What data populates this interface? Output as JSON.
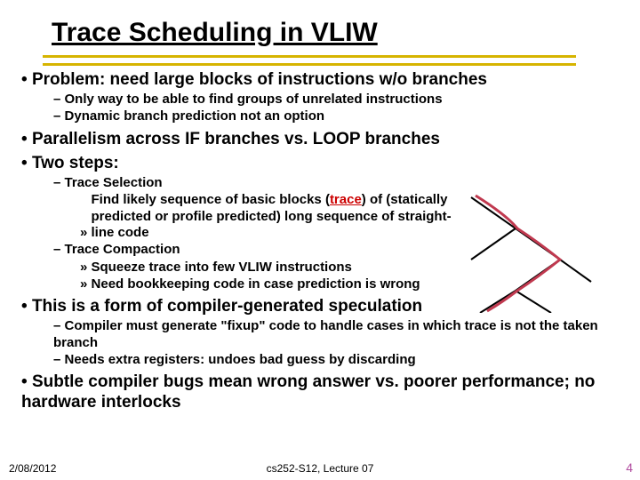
{
  "title": "Trace Scheduling in VLIW",
  "b1": {
    "problem": "Problem: need large blocks of instructions w/o branches",
    "sub1": "Only way to be able to find groups of unrelated instructions",
    "sub2": "Dynamic branch prediction not an option"
  },
  "b2": "Parallelism across IF branches vs. LOOP branches",
  "b3": {
    "head": "Two steps:",
    "ts": "Trace Selection",
    "ts_detail_pre": "Find likely sequence of basic blocks (",
    "ts_detail_link": "trace",
    "ts_detail_post": ") of (statically predicted or profile predicted) long sequence of straight-line code",
    "tc": "Trace Compaction",
    "tc_d1": "Squeeze trace into few VLIW instructions",
    "tc_d2": "Need bookkeeping code in case prediction is wrong"
  },
  "b4": {
    "head": "This is a form of compiler-generated speculation",
    "s1": "Compiler must generate \"fixup\" code to handle cases in which trace is not the taken branch",
    "s2": "Needs extra registers: undoes bad guess by discarding"
  },
  "b5": "Subtle compiler bugs mean wrong answer vs. poorer performance; no hardware interlocks",
  "footer": {
    "date": "2/08/2012",
    "course": "cs252-S12, Lecture 07",
    "page": "4"
  }
}
